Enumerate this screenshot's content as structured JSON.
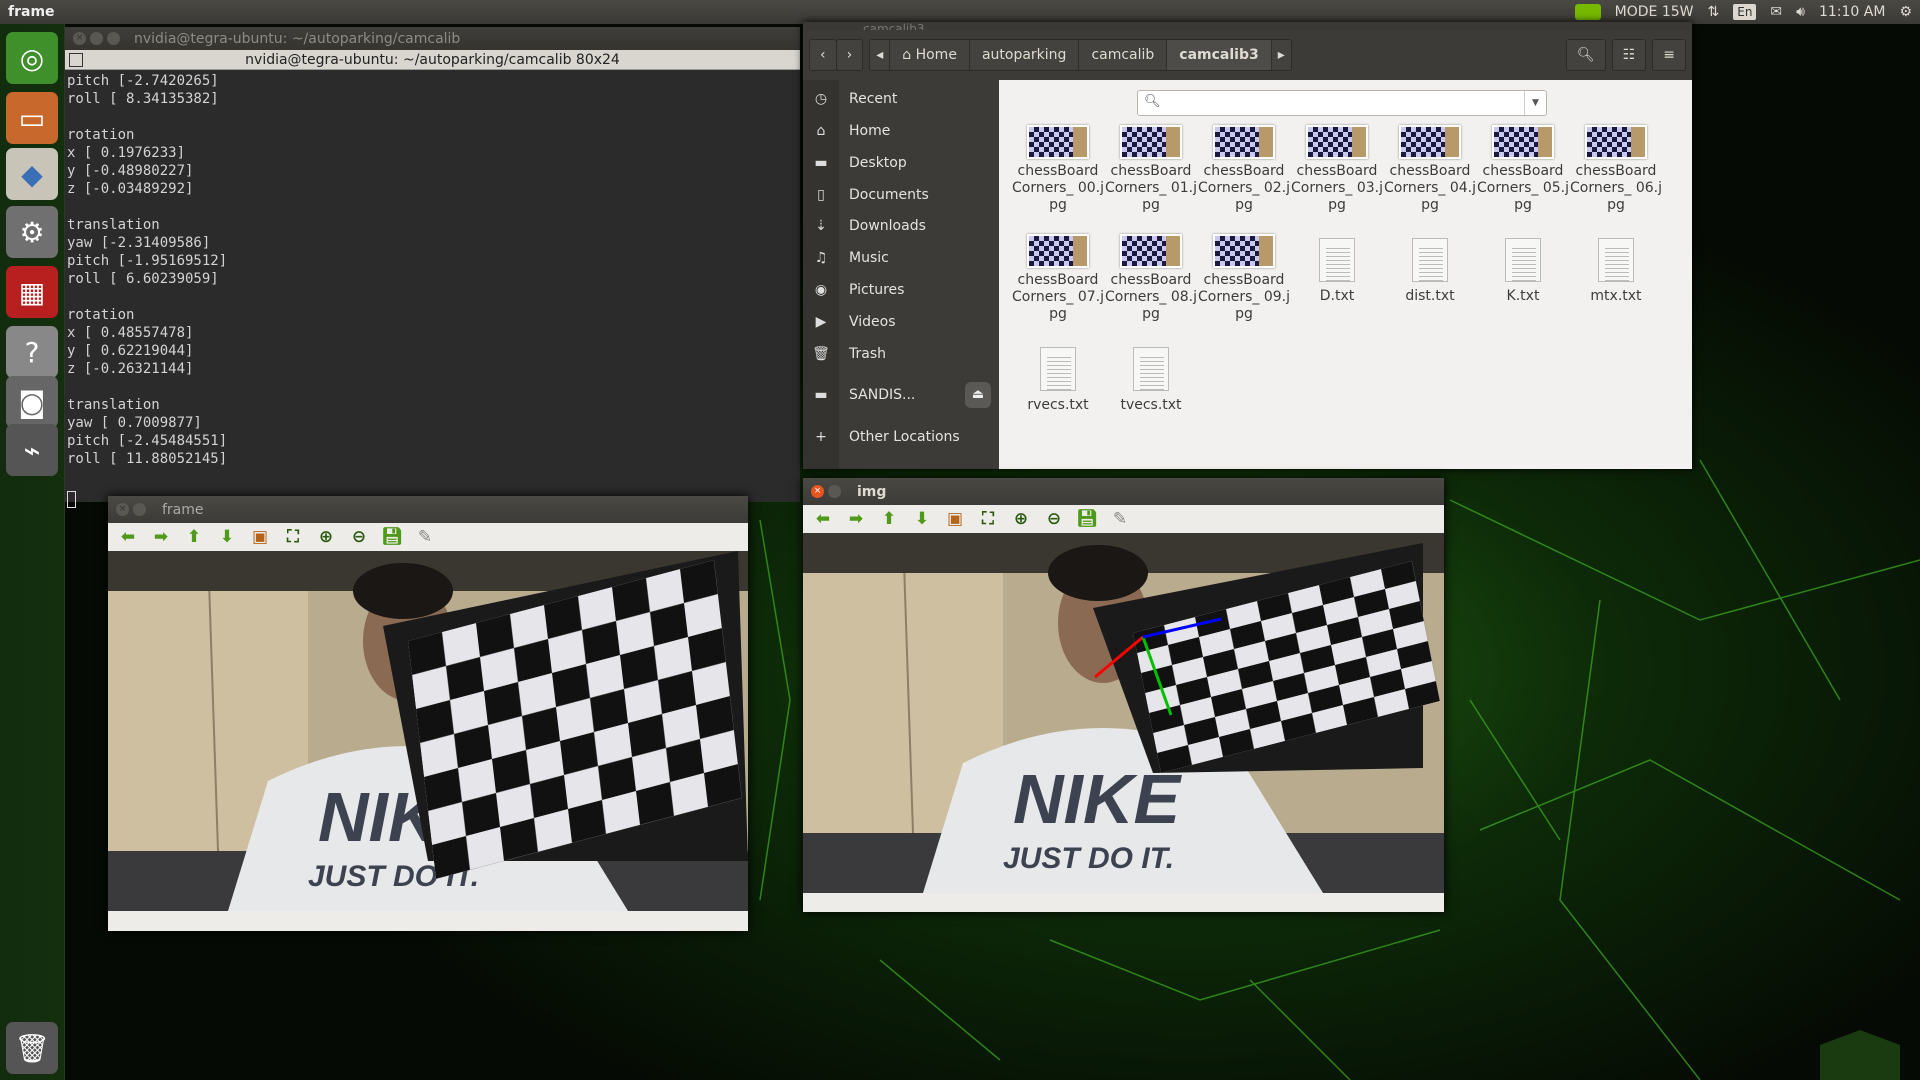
{
  "topbar": {
    "app_title": "frame",
    "mode": "MODE 15W",
    "lang": "En",
    "time": "11:10 AM"
  },
  "launcher": {
    "items": [
      "dash-home",
      "files",
      "software-center",
      "system-settings",
      "workspace-switcher",
      "help",
      "screenshot",
      "usb-drive",
      "trash"
    ]
  },
  "terminal": {
    "title": "nvidia@tegra-ubuntu: ~/autoparking/camcalib",
    "subtitle": "nvidia@tegra-ubuntu: ~/autoparking/camcalib 80x24",
    "lines": [
      "pitch [-2.7420265]",
      "roll [ 8.34135382]",
      "",
      "rotation",
      "x [ 0.1976233]",
      "y [-0.48980227]",
      "z [-0.03489292]",
      "",
      "translation",
      "yaw [-2.31409586]",
      "pitch [-1.95169512]",
      "roll [ 6.60239059]",
      "",
      "rotation",
      "x [ 0.48557478]",
      "y [ 0.62219044]",
      "z [-0.26321144]",
      "",
      "translation",
      "yaw [ 0.7009877]",
      "pitch [-2.45484551]",
      "roll [ 11.88052145]",
      ""
    ]
  },
  "files": {
    "title": "camcalib3",
    "breadcrumbs": [
      "Home",
      "autoparking",
      "camcalib",
      "camcalib3"
    ],
    "sidebar": [
      {
        "icon": "clock",
        "label": "Recent"
      },
      {
        "icon": "home",
        "label": "Home"
      },
      {
        "icon": "folder",
        "label": "Desktop"
      },
      {
        "icon": "document",
        "label": "Documents"
      },
      {
        "icon": "download",
        "label": "Downloads"
      },
      {
        "icon": "music",
        "label": "Music"
      },
      {
        "icon": "camera",
        "label": "Pictures"
      },
      {
        "icon": "video",
        "label": "Videos"
      },
      {
        "icon": "trash",
        "label": "Trash"
      },
      {
        "icon": "drive",
        "label": "SANDIS..."
      },
      {
        "icon": "plus",
        "label": "Other Locations"
      }
    ],
    "items": [
      {
        "name": "chessBoard Corners_ 00.jpg",
        "type": "image"
      },
      {
        "name": "chessBoard Corners_ 01.jpg",
        "type": "image"
      },
      {
        "name": "chessBoard Corners_ 02.jpg",
        "type": "image"
      },
      {
        "name": "chessBoard Corners_ 03.jpg",
        "type": "image"
      },
      {
        "name": "chessBoard Corners_ 04.jpg",
        "type": "image"
      },
      {
        "name": "chessBoard Corners_ 05.jpg",
        "type": "image"
      },
      {
        "name": "chessBoard Corners_ 06.jpg",
        "type": "image"
      },
      {
        "name": "chessBoard Corners_ 07.jpg",
        "type": "image"
      },
      {
        "name": "chessBoard Corners_ 08.jpg",
        "type": "image"
      },
      {
        "name": "chessBoard Corners_ 09.jpg",
        "type": "image"
      },
      {
        "name": "D.txt",
        "type": "text"
      },
      {
        "name": "dist.txt",
        "type": "text"
      },
      {
        "name": "K.txt",
        "type": "text"
      },
      {
        "name": "mtx.txt",
        "type": "text"
      },
      {
        "name": "rvecs.txt",
        "type": "text"
      },
      {
        "name": "tvecs.txt",
        "type": "text"
      }
    ]
  },
  "frame_window": {
    "title": "frame"
  },
  "img_window": {
    "title": "img"
  },
  "toolbar_icons": [
    "arrow-left",
    "arrow-right",
    "arrow-up",
    "arrow-down",
    "image",
    "zoom-fit",
    "zoom-in",
    "zoom-out",
    "save",
    "properties"
  ],
  "shirt_text": {
    "brand": "NIKE",
    "slogan": "JUST DO IT."
  },
  "colors": {
    "accent": "#76b900",
    "close": "#e95420",
    "axis_x": "#ff0000",
    "axis_y": "#00c000",
    "axis_z": "#0000ff"
  }
}
